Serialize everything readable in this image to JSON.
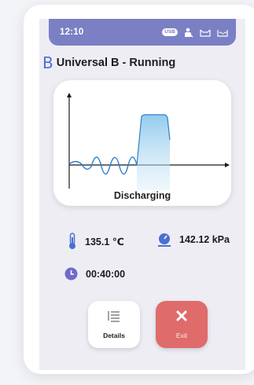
{
  "status_bar": {
    "time": "12:10",
    "usb_label": "USB",
    "icons": [
      "usb-icon",
      "user-icon",
      "tray-icon",
      "bath-icon"
    ]
  },
  "header": {
    "logo_glyph": "B",
    "title": "Universal B - Running"
  },
  "chart_card": {
    "phase_label": "Discharging"
  },
  "readings": {
    "temperature": "135.1 ℃",
    "pressure": "142.12 kPa",
    "time_remaining": "00:40:00"
  },
  "buttons": {
    "details_label": "Details",
    "exit_label": "Exit"
  },
  "colors": {
    "status_bar": "#7b7fc4",
    "accent_blue": "#4a6fd0",
    "exit_red": "#df6b6b",
    "screen_bg": "#eeedf4"
  }
}
